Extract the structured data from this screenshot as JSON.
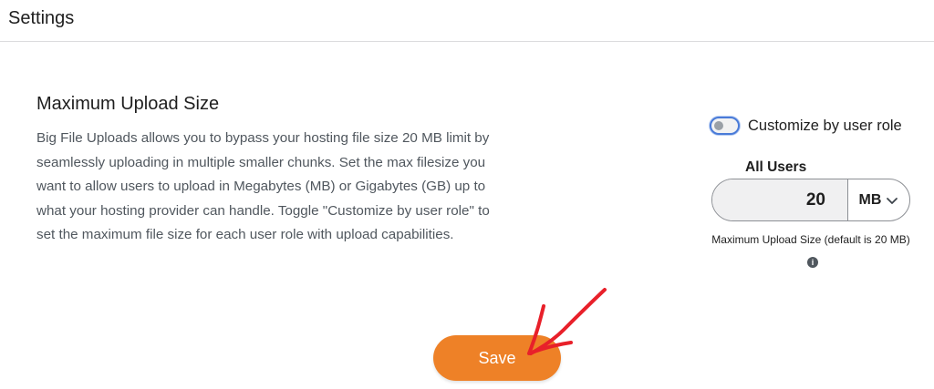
{
  "header": {
    "title": "Settings"
  },
  "section": {
    "title": "Maximum Upload Size",
    "description": "Big File Uploads allows you to bypass your hosting file size 20 MB limit by seamlessly uploading in multiple smaller chunks. Set the max filesize you want to allow users to upload in Megabytes (MB) or Gigabytes (GB) up to what your hosting provider can handle. Toggle \"Customize by user role\" to set the maximum file size for each user role with upload capabilities."
  },
  "role_toggle": {
    "label": "Customize by user role",
    "enabled": false
  },
  "all_users": {
    "label": "All Users",
    "size_value": "20",
    "unit": "MB",
    "help_text": "Maximum Upload Size (default is 20 MB)",
    "info_icon": "info-icon"
  },
  "actions": {
    "save_label": "Save"
  },
  "colors": {
    "save_button": "#ee8127",
    "toggle_focus": "#4a7bd8",
    "annotation_arrow": "#e8202a"
  }
}
